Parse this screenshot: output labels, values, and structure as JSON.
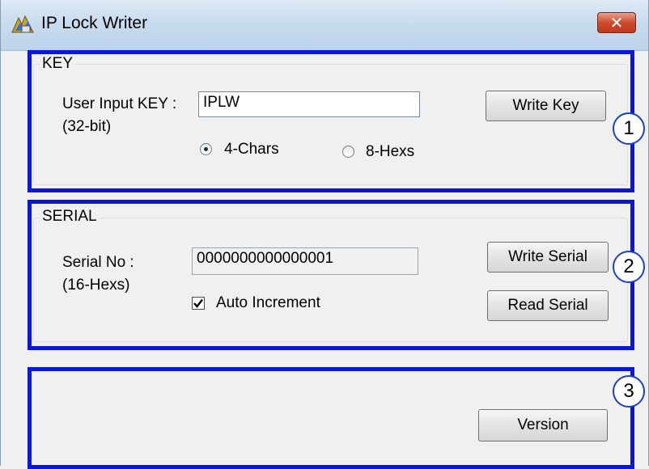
{
  "window": {
    "title": "IP Lock Writer",
    "close_symbol": "✕"
  },
  "key_group": {
    "title": "KEY",
    "label": "User Input KEY :",
    "sublabel": "(32-bit)",
    "input_value": "IPLW",
    "write_button": "Write Key",
    "radio_4chars": "4-Chars",
    "radio_8hexs": "8-Hexs",
    "selected_mode": "4-Chars",
    "annotation": "1"
  },
  "serial_group": {
    "title": "SERIAL",
    "label": "Serial No :",
    "sublabel": "(16-Hexs)",
    "input_value": "0000000000000001",
    "write_button": "Write Serial",
    "read_button": "Read Serial",
    "auto_increment_label": "Auto Increment",
    "auto_increment_checked": true,
    "annotation": "2"
  },
  "bottom_group": {
    "version_button": "Version",
    "annotation": "3"
  },
  "colors": {
    "highlight": "#0a17d8",
    "close_button": "#cf4b2e"
  }
}
